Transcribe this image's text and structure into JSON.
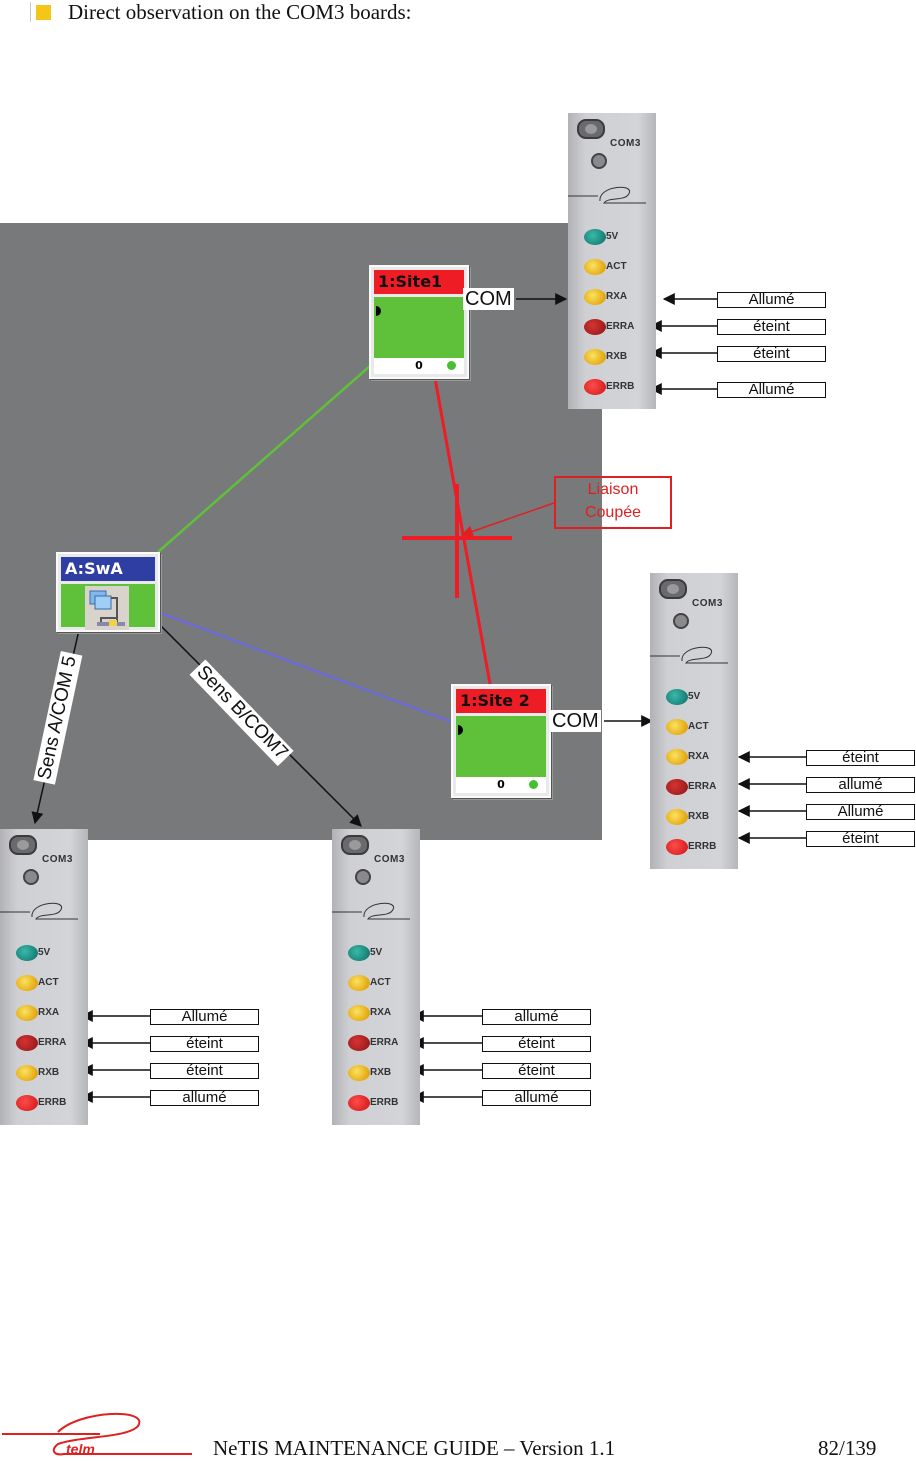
{
  "heading": {
    "text": "Direct observation on the COM3 boards:"
  },
  "nodes": {
    "site1": {
      "title": "1:Site1",
      "count": "0",
      "com_label": "COM"
    },
    "site2": {
      "title": "1:Site 2",
      "count": "0",
      "com_label": "COM"
    },
    "swa": {
      "title": "A:SwA"
    }
  },
  "link_labels": {
    "sens_a": "Sens A/COM 5",
    "sens_b": "Sens B/COM7"
  },
  "callout": {
    "line1": "Liaison",
    "line2": "Coupée"
  },
  "board_template": {
    "name": "COM3",
    "signals": [
      "5V",
      "ACT",
      "RXA",
      "ERRA",
      "RXB",
      "ERRB"
    ]
  },
  "boards": {
    "site1": {
      "states": [
        "Allumé",
        "éteint",
        "éteint",
        "Allumé"
      ]
    },
    "site2": {
      "states": [
        "éteint",
        "allumé",
        "Allumé",
        "éteint"
      ]
    },
    "sens_a": {
      "states": [
        "Allumé",
        "éteint",
        "éteint",
        "allumé"
      ]
    },
    "sens_b": {
      "states": [
        "allumé",
        "éteint",
        "éteint",
        "allumé"
      ]
    }
  },
  "colors": {
    "canvas": "#78797b",
    "site_header": "#ee1c25",
    "switch_header": "#2e3ea3",
    "node_body": "#5ec139",
    "link_green": "#5ec139",
    "link_red": "#ee1c25",
    "link_blue": "#6b6bd6",
    "callout": "#e02020",
    "logo_red": "#e02020",
    "bullet": "#f5c518"
  },
  "footer": {
    "logo_text": "telm",
    "title": "NeTIS MAINTENANCE GUIDE – Version 1.1",
    "page": "82/139"
  }
}
